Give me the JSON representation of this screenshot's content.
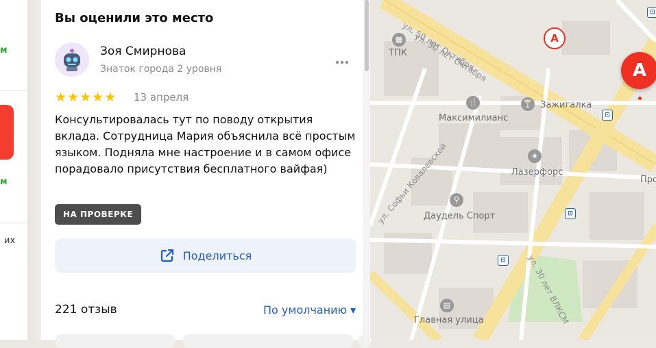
{
  "left_panel": {
    "edge_texts": [
      "м",
      "м",
      "их"
    ]
  },
  "review": {
    "section_title": "Вы оценили это место",
    "user_name": "Зоя Смирнова",
    "user_level": "Знаток города 2 уровня",
    "rating": 5,
    "date": "13 апреля",
    "text": "Консультировалась тут по поводу открытия вклада. Сотрудница Мария объяснила всё простым языком. Подняла мне настроение и в самом офисе порадовало присутствия бесплатного вайфая)",
    "status_badge": "НА ПРОВЕРКЕ",
    "share_label": "Поделиться"
  },
  "reviews_footer": {
    "count": "221 отзыв",
    "sort_label": "По умолчанию ▾"
  },
  "map": {
    "streets": [
      "ул. 50 лет Октября",
      "ул. 50 лет Октября",
      "ул. Софьи Ковалевской",
      "ул. 30 лет ВЛКСМ"
    ],
    "pois": [
      "ТПК",
      "Максимилианс",
      "Зажигалка",
      "Лазерфорс",
      "Даудель Спорт",
      "Главная улица",
      "Про"
    ],
    "bank_marker_letter": "А",
    "colors": {
      "bank_red": "#ef3124",
      "road_yellow": "#f6e29a",
      "park_green": "#cfe8c2",
      "link_blue": "#1f5ebf",
      "star": "#ffc400"
    }
  }
}
